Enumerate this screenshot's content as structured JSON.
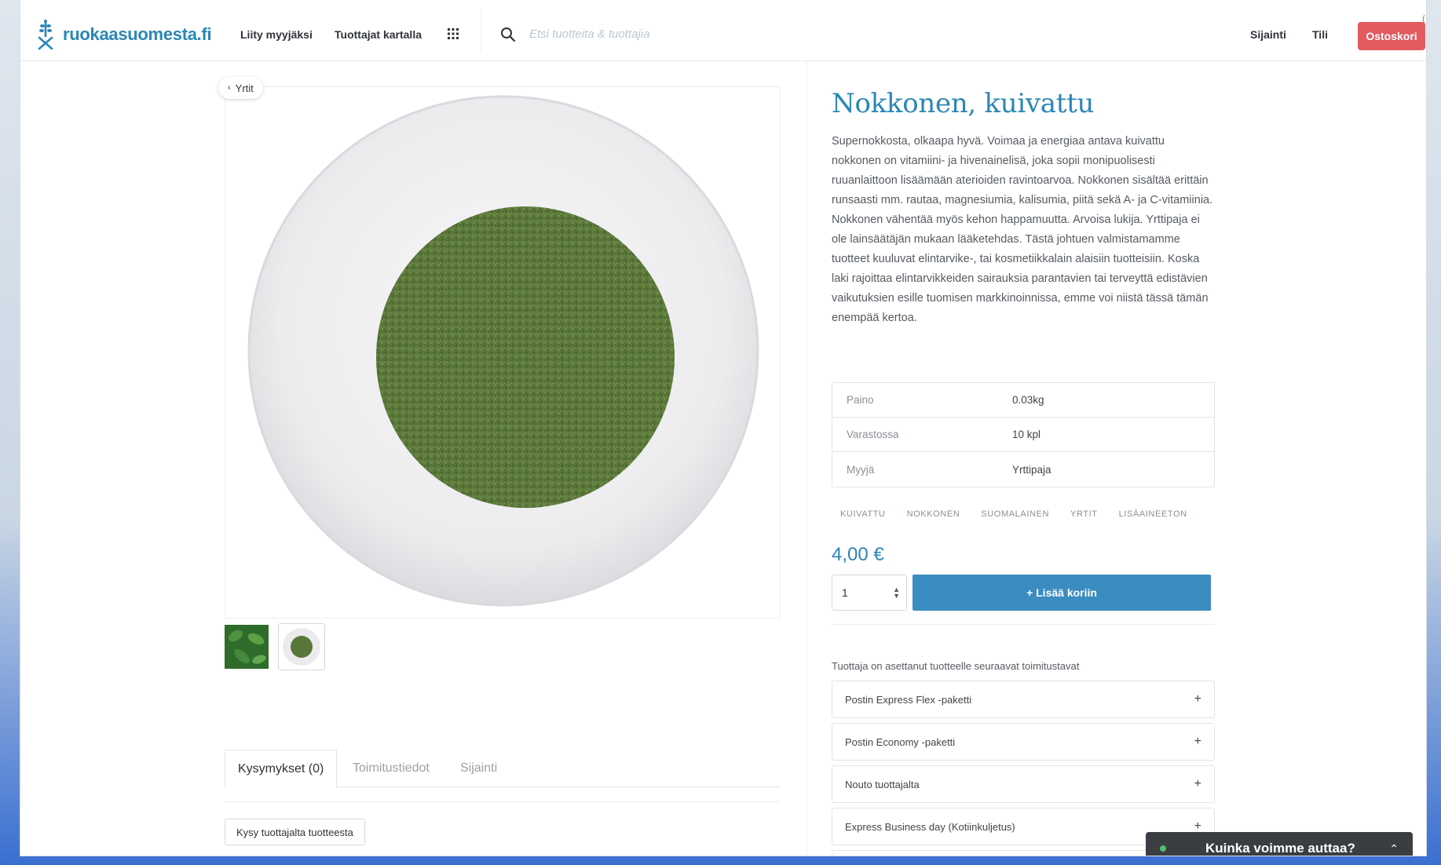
{
  "header": {
    "logo_text": "ruokaasuomesta.fi",
    "nav": [
      "Liity myyjäksi",
      "Tuottajat kartalla"
    ],
    "search_placeholder": "Etsi tuotteita & tuottajia",
    "right_links": [
      "Sijainti",
      "Tili"
    ],
    "cart_label": "Ostoskori",
    "cart_badge": "("
  },
  "breadcrumb": {
    "back_label": "Yrtit"
  },
  "product": {
    "title": "Nokkonen, kuivattu",
    "description": "Supernokkosta, olkaapa hyvä. Voimaa ja energiaa antava kuivattu nokkonen on vitamiini- ja hivenainelisä, joka sopii monipuolisesti ruuanlaittoon lisäämään aterioiden ravintoarvoa. Nokkonen sisältää erittäin runsaasti mm. rautaa, magnesiumia, kalisumia, piitä sekä A- ja C-vitamiinia. Nokkonen vähentää myös kehon happamuutta. Arvoisa lukija. Yrttipaja ei ole lainsäätäjän mukaan lääketehdas. Tästä johtuen valmistamamme tuotteet kuuluvat elintarvike-, tai kosmetiikkalain alaisiin tuotteisiin. Koska laki rajoittaa elintarvikkeiden sairauksia parantavien tai terveyttä edistävien vaikutuksien esille tuomisen markkinoinnissa, emme voi niistä tässä tämän enempää kertoa.",
    "details": [
      {
        "key": "Paino",
        "value": "0.03kg"
      },
      {
        "key": "Varastossa",
        "value": "10 kpl"
      },
      {
        "key": "Myyjä",
        "value": "Yrttipaja"
      }
    ],
    "tags": [
      "KUIVATTU",
      "NOKKONEN",
      "SUOMALAINEN",
      "YRTIT",
      "LISÄAINEETON"
    ],
    "price": "4,00 €",
    "quantity": "1",
    "add_to_cart": "+ Lisää koriin"
  },
  "tabs": [
    "Kysymykset (0)",
    "Toimitustiedot",
    "Sijainti"
  ],
  "ask_button": "Kysy tuottajalta tuotteesta",
  "shipping": {
    "caption": "Tuottaja on asettanut tuotteelle seuraavat toimitustavat",
    "methods": [
      "Postin Express Flex -paketti",
      "Postin Economy -paketti",
      "Nouto tuottajalta",
      "Express Business day (Kotiinkuljetus)"
    ]
  },
  "chat": {
    "label": "Kuinka voimme auttaa?"
  },
  "colors": {
    "brand": "#2b86b6",
    "cart": "#e35a5f",
    "button": "#3b8cc0"
  },
  "icons": [
    "logo-mark-icon",
    "grid-icon",
    "search-icon",
    "chevron-left-icon",
    "plus-icon",
    "chevron-up-icon"
  ]
}
